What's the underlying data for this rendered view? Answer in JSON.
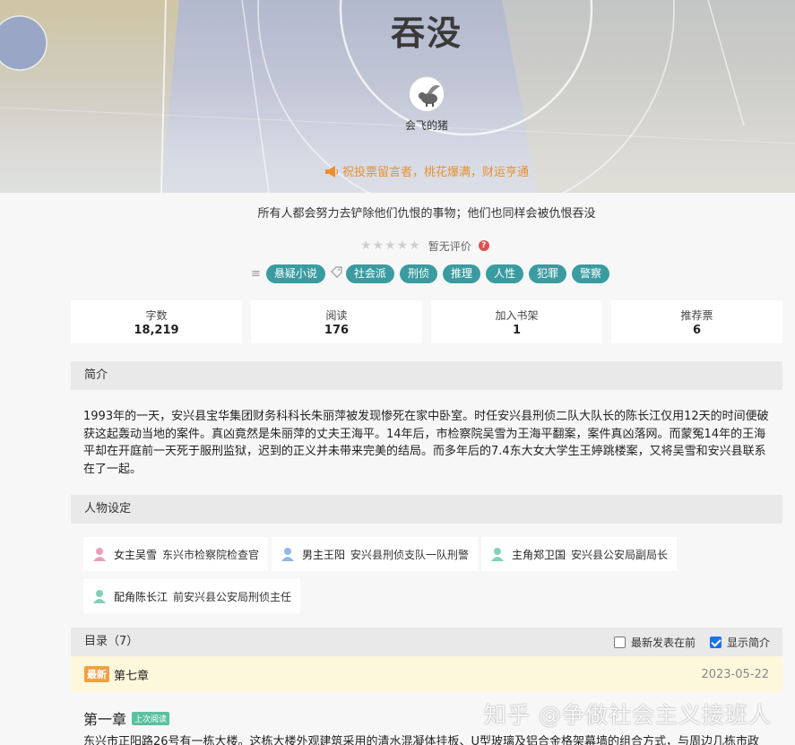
{
  "book": {
    "title": "吞没",
    "author": "会飞的猪",
    "notice": "祝投票留言者，桃花爆满，财运亨通",
    "slogan": "所有人都会努力去铲除他们仇恨的事物；他们也同样会被仇恨吞没",
    "rating_text": "暂无评价",
    "rating_stars": 0,
    "category_tag": "悬疑小说",
    "tags": [
      "社会派",
      "刑侦",
      "推理",
      "人性",
      "犯罪",
      "警察"
    ]
  },
  "stats": [
    {
      "label": "字数",
      "value": "18,219"
    },
    {
      "label": "阅读",
      "value": "176"
    },
    {
      "label": "加入书架",
      "value": "1"
    },
    {
      "label": "推荐票",
      "value": "6"
    }
  ],
  "intro": {
    "heading": "简介",
    "text": "1993年的一天，安兴县宝华集团财务科科长朱丽萍被发现惨死在家中卧室。时任安兴县刑侦二队大队长的陈长江仅用12天的时间便破获这起轰动当地的案件。真凶竟然是朱丽萍的丈夫王海平。14年后，市检察院吴雪为王海平翻案，案件真凶落网。而蒙冤14年的王海平却在开庭前一天死于服刑监狱，迟到的正义并未带来完美的结局。而多年后的7.4东大女大学生王婷跳楼案，又将吴雪和安兴县联系在了一起。"
  },
  "characters": {
    "heading": "人物设定",
    "items": [
      {
        "role": "女主吴雪",
        "desc": "东兴市检察院检查官",
        "color": "#e8a0b8"
      },
      {
        "role": "男主王阳",
        "desc": "安兴县刑侦支队一队刑警",
        "color": "#90b8e8"
      },
      {
        "role": "主角郑卫国",
        "desc": "安兴县公安局副局长",
        "color": "#80d0b8"
      },
      {
        "role": "配角陈长江",
        "desc": "前安兴县公安局刑侦主任",
        "color": "#80d0b8"
      }
    ]
  },
  "toc": {
    "heading": "目录（7）",
    "opt_newest_first": "最新发表在前",
    "opt_newest_first_checked": false,
    "opt_show_intro": "显示简介",
    "opt_show_intro_checked": true,
    "latest_badge": "最新",
    "latest_title": "第七章",
    "latest_date": "2023-05-22",
    "first_chapter_title": "第一章",
    "first_chapter_badge": "上次阅读",
    "first_chapter_text": "东兴市正阳路26号有一栋大楼。这栋大楼外观建筑采用的清水混凝体挂板、U型玻璃及铝合金格架幕墙的组合方式，与周边几栋市政"
  },
  "watermark": "知乎 @争做社会主义接班人"
}
